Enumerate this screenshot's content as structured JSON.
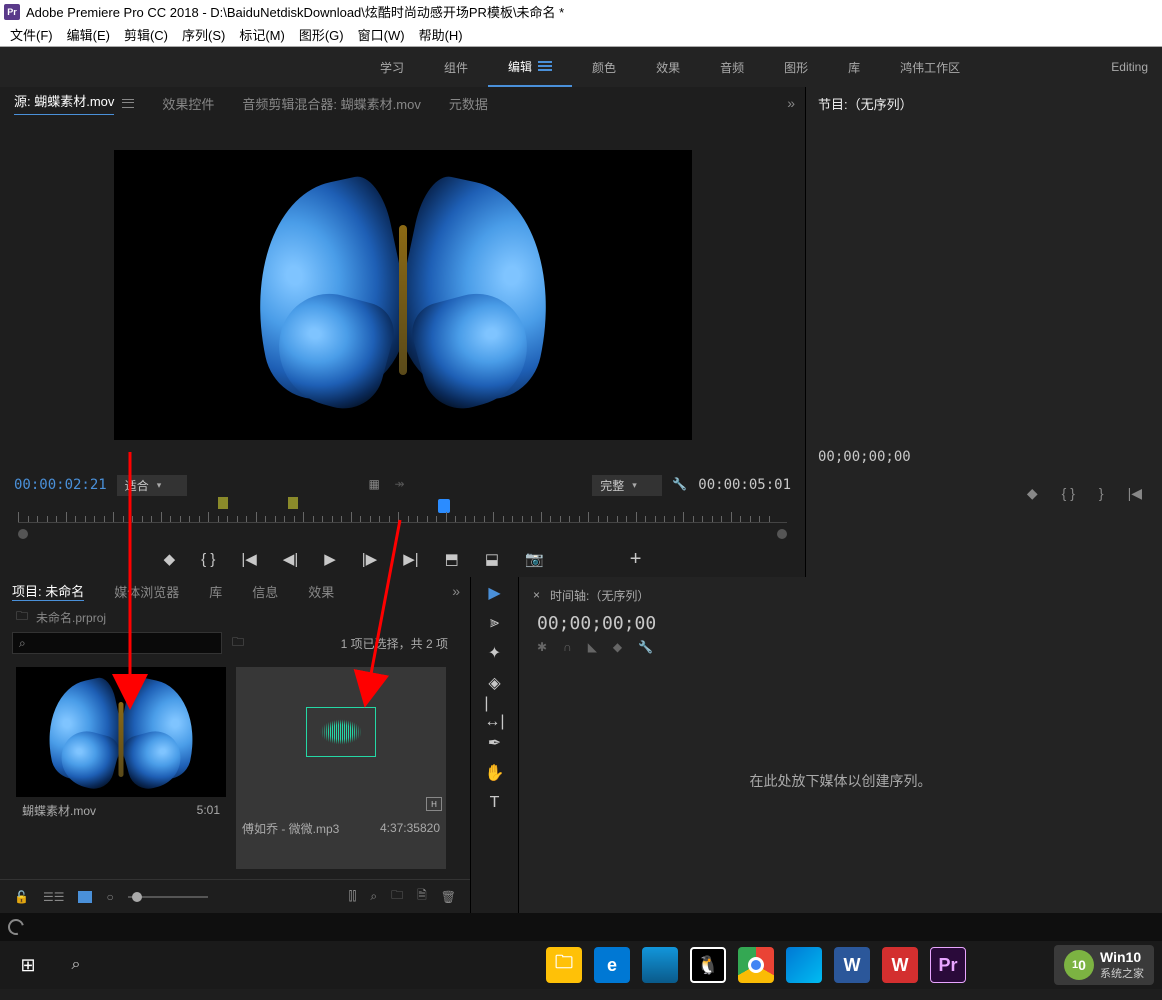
{
  "titlebar": {
    "app_icon": "Pr",
    "title": "Adobe Premiere Pro CC 2018 - D:\\BaiduNetdiskDownload\\炫酷时尚动感开场PR模板\\未命名 *"
  },
  "menubar": [
    "文件(F)",
    "编辑(E)",
    "剪辑(C)",
    "序列(S)",
    "标记(M)",
    "图形(G)",
    "窗口(W)",
    "帮助(H)"
  ],
  "workspaces": {
    "tabs": [
      "学习",
      "组件",
      "编辑",
      "颜色",
      "效果",
      "音频",
      "图形",
      "库",
      "鸿伟工作区"
    ],
    "active": 2,
    "editing": "Editing"
  },
  "source": {
    "tabs": [
      "源: 蝴蝶素材.mov",
      "效果控件",
      "音频剪辑混合器: 蝴蝶素材.mov",
      "元数据"
    ],
    "active": 0,
    "tc_left": "00:00:02:21",
    "fit": "适合",
    "quality": "完整",
    "tc_right": "00:00:05:01"
  },
  "program": {
    "title": "节目:（无序列）",
    "tc": "00;00;00;00"
  },
  "project": {
    "tabs": [
      "项目: 未命名",
      "媒体浏览器",
      "库",
      "信息",
      "效果"
    ],
    "active": 0,
    "breadcrumb": "未命名.prproj",
    "search_placeholder": "",
    "info": "1 项已选择，共 2 项",
    "clips": [
      {
        "name": "蝴蝶素材.mov",
        "dur": "5:01",
        "type": "video"
      },
      {
        "name": "傅如乔 - 微微.mp3",
        "dur": "4:37:35820",
        "type": "audio"
      }
    ]
  },
  "timeline": {
    "title": "时间轴:（无序列）",
    "tc": "00;00;00;00",
    "hint": "在此处放下媒体以创建序列。"
  },
  "win10": {
    "big": "Win10",
    "small": "系统之家"
  }
}
